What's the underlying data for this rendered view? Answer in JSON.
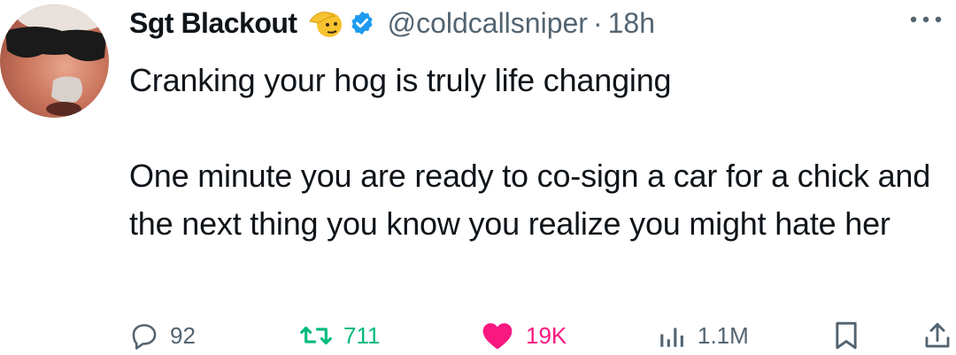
{
  "author": {
    "name": "Sgt Blackout",
    "handle": "@coldcallsniper",
    "separator": "·",
    "time": "18h",
    "emoji_icon": "saluting-face-icon",
    "verified_icon": "verified-badge-icon"
  },
  "tweet": {
    "text": "Cranking your hog is truly life changing\n\nOne minute you are ready to co-sign a car for a chick and the next thing you know you realize you might hate her"
  },
  "actions": {
    "replies": "92",
    "retweets": "711",
    "likes": "19K",
    "views": "1.1M"
  },
  "colors": {
    "text": "#0f1419",
    "secondary": "#536471",
    "verified": "#1d9bf0",
    "retweet": "#00ba7c",
    "like": "#f91880"
  }
}
